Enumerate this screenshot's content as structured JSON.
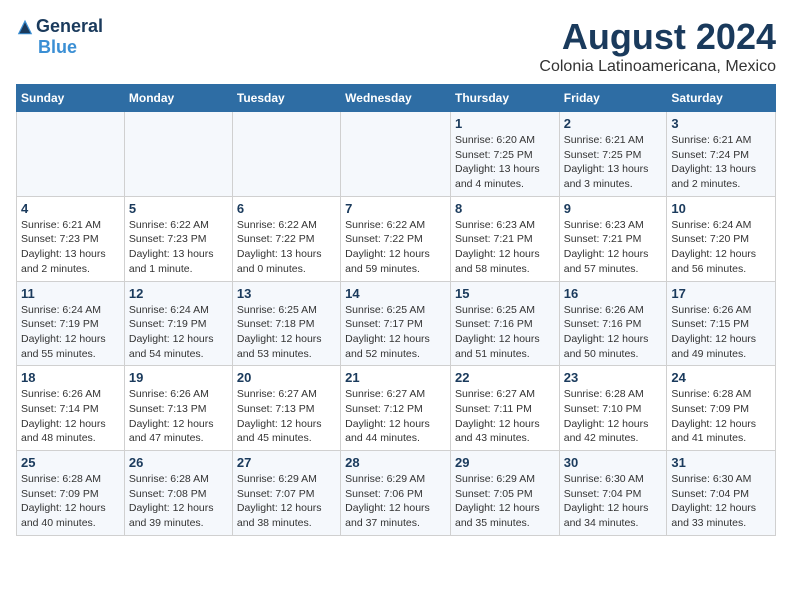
{
  "logo": {
    "general": "General",
    "blue": "Blue",
    "icon": "▶"
  },
  "title": "August 2024",
  "subtitle": "Colonia Latinoamericana, Mexico",
  "headers": [
    "Sunday",
    "Monday",
    "Tuesday",
    "Wednesday",
    "Thursday",
    "Friday",
    "Saturday"
  ],
  "weeks": [
    [
      {
        "day": "",
        "content": ""
      },
      {
        "day": "",
        "content": ""
      },
      {
        "day": "",
        "content": ""
      },
      {
        "day": "",
        "content": ""
      },
      {
        "day": "1",
        "content": "Sunrise: 6:20 AM\nSunset: 7:25 PM\nDaylight: 13 hours and 4 minutes."
      },
      {
        "day": "2",
        "content": "Sunrise: 6:21 AM\nSunset: 7:25 PM\nDaylight: 13 hours and 3 minutes."
      },
      {
        "day": "3",
        "content": "Sunrise: 6:21 AM\nSunset: 7:24 PM\nDaylight: 13 hours and 2 minutes."
      }
    ],
    [
      {
        "day": "4",
        "content": "Sunrise: 6:21 AM\nSunset: 7:23 PM\nDaylight: 13 hours and 2 minutes."
      },
      {
        "day": "5",
        "content": "Sunrise: 6:22 AM\nSunset: 7:23 PM\nDaylight: 13 hours and 1 minute."
      },
      {
        "day": "6",
        "content": "Sunrise: 6:22 AM\nSunset: 7:22 PM\nDaylight: 13 hours and 0 minutes."
      },
      {
        "day": "7",
        "content": "Sunrise: 6:22 AM\nSunset: 7:22 PM\nDaylight: 12 hours and 59 minutes."
      },
      {
        "day": "8",
        "content": "Sunrise: 6:23 AM\nSunset: 7:21 PM\nDaylight: 12 hours and 58 minutes."
      },
      {
        "day": "9",
        "content": "Sunrise: 6:23 AM\nSunset: 7:21 PM\nDaylight: 12 hours and 57 minutes."
      },
      {
        "day": "10",
        "content": "Sunrise: 6:24 AM\nSunset: 7:20 PM\nDaylight: 12 hours and 56 minutes."
      }
    ],
    [
      {
        "day": "11",
        "content": "Sunrise: 6:24 AM\nSunset: 7:19 PM\nDaylight: 12 hours and 55 minutes."
      },
      {
        "day": "12",
        "content": "Sunrise: 6:24 AM\nSunset: 7:19 PM\nDaylight: 12 hours and 54 minutes."
      },
      {
        "day": "13",
        "content": "Sunrise: 6:25 AM\nSunset: 7:18 PM\nDaylight: 12 hours and 53 minutes."
      },
      {
        "day": "14",
        "content": "Sunrise: 6:25 AM\nSunset: 7:17 PM\nDaylight: 12 hours and 52 minutes."
      },
      {
        "day": "15",
        "content": "Sunrise: 6:25 AM\nSunset: 7:16 PM\nDaylight: 12 hours and 51 minutes."
      },
      {
        "day": "16",
        "content": "Sunrise: 6:26 AM\nSunset: 7:16 PM\nDaylight: 12 hours and 50 minutes."
      },
      {
        "day": "17",
        "content": "Sunrise: 6:26 AM\nSunset: 7:15 PM\nDaylight: 12 hours and 49 minutes."
      }
    ],
    [
      {
        "day": "18",
        "content": "Sunrise: 6:26 AM\nSunset: 7:14 PM\nDaylight: 12 hours and 48 minutes."
      },
      {
        "day": "19",
        "content": "Sunrise: 6:26 AM\nSunset: 7:13 PM\nDaylight: 12 hours and 47 minutes."
      },
      {
        "day": "20",
        "content": "Sunrise: 6:27 AM\nSunset: 7:13 PM\nDaylight: 12 hours and 45 minutes."
      },
      {
        "day": "21",
        "content": "Sunrise: 6:27 AM\nSunset: 7:12 PM\nDaylight: 12 hours and 44 minutes."
      },
      {
        "day": "22",
        "content": "Sunrise: 6:27 AM\nSunset: 7:11 PM\nDaylight: 12 hours and 43 minutes."
      },
      {
        "day": "23",
        "content": "Sunrise: 6:28 AM\nSunset: 7:10 PM\nDaylight: 12 hours and 42 minutes."
      },
      {
        "day": "24",
        "content": "Sunrise: 6:28 AM\nSunset: 7:09 PM\nDaylight: 12 hours and 41 minutes."
      }
    ],
    [
      {
        "day": "25",
        "content": "Sunrise: 6:28 AM\nSunset: 7:09 PM\nDaylight: 12 hours and 40 minutes."
      },
      {
        "day": "26",
        "content": "Sunrise: 6:28 AM\nSunset: 7:08 PM\nDaylight: 12 hours and 39 minutes."
      },
      {
        "day": "27",
        "content": "Sunrise: 6:29 AM\nSunset: 7:07 PM\nDaylight: 12 hours and 38 minutes."
      },
      {
        "day": "28",
        "content": "Sunrise: 6:29 AM\nSunset: 7:06 PM\nDaylight: 12 hours and 37 minutes."
      },
      {
        "day": "29",
        "content": "Sunrise: 6:29 AM\nSunset: 7:05 PM\nDaylight: 12 hours and 35 minutes."
      },
      {
        "day": "30",
        "content": "Sunrise: 6:30 AM\nSunset: 7:04 PM\nDaylight: 12 hours and 34 minutes."
      },
      {
        "day": "31",
        "content": "Sunrise: 6:30 AM\nSunset: 7:04 PM\nDaylight: 12 hours and 33 minutes."
      }
    ]
  ]
}
